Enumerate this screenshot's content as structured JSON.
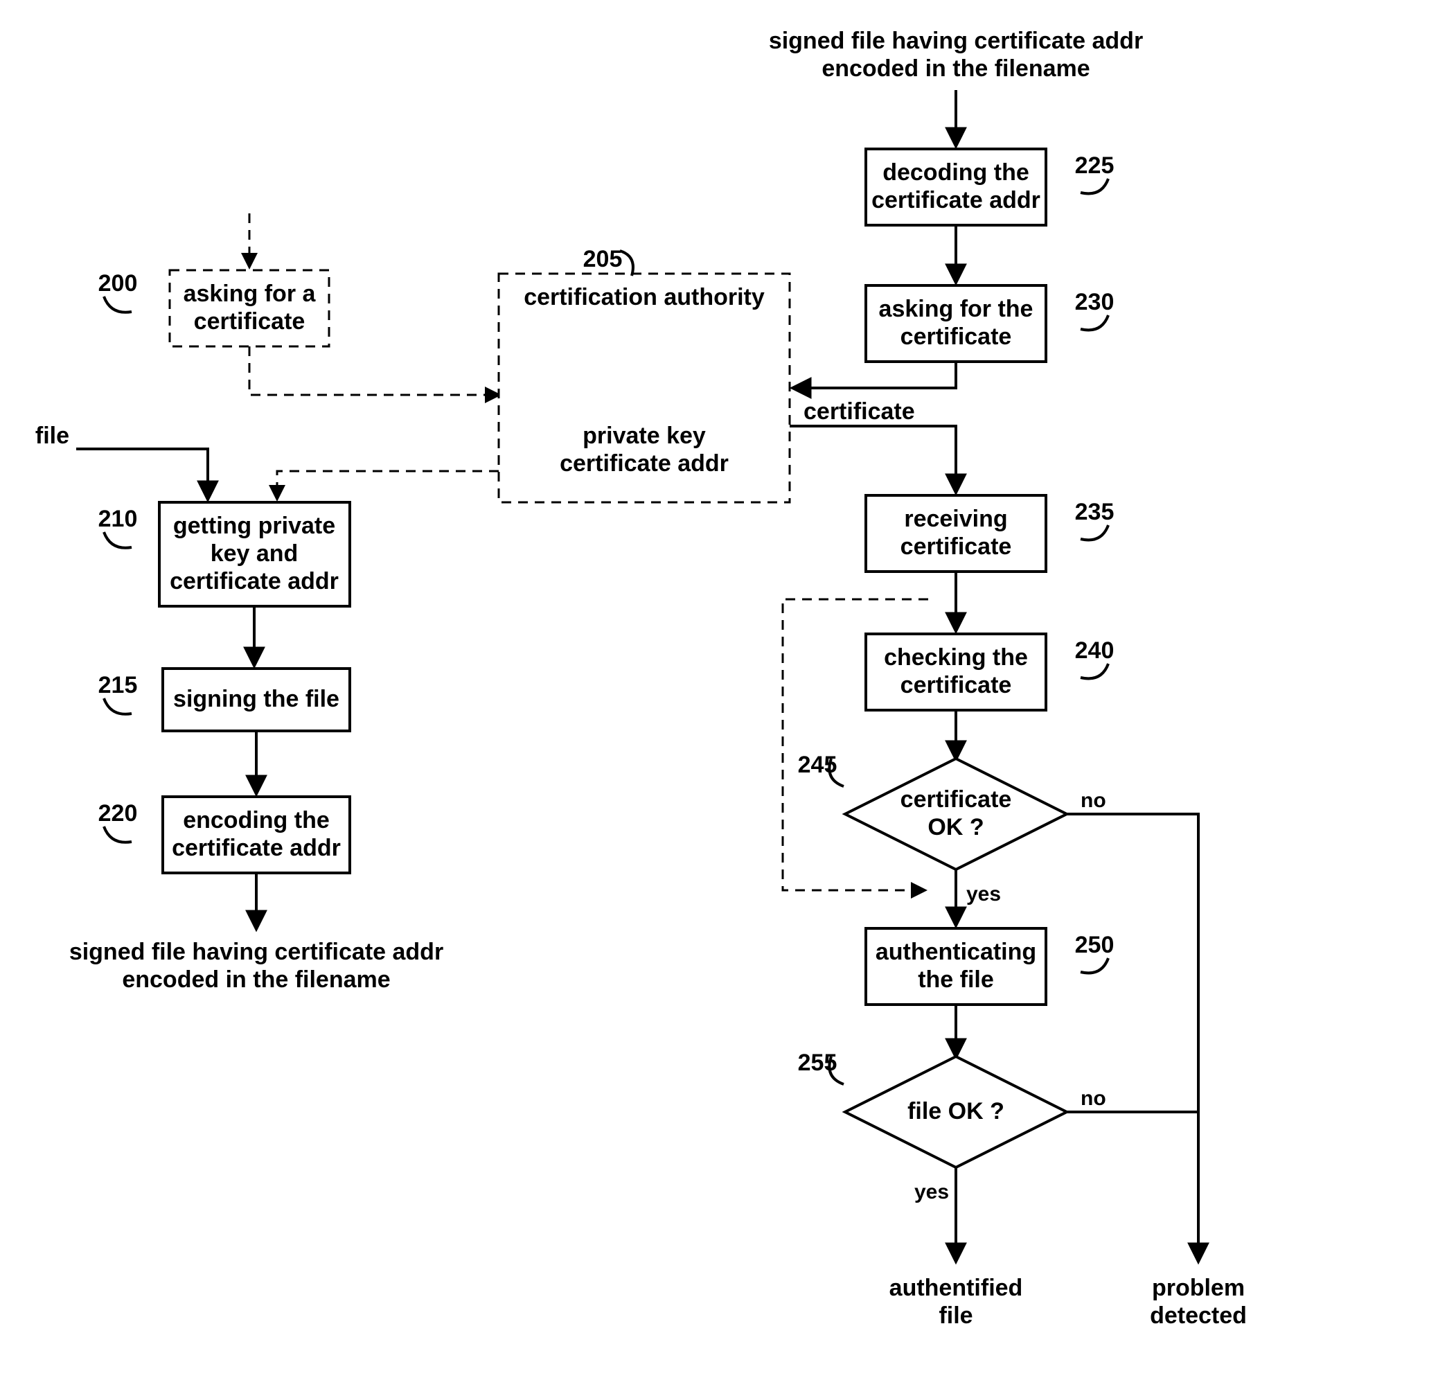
{
  "top_right_input_l1": "signed file having certificate addr",
  "top_right_input_l2": "encoded in the filename",
  "file_label": "file",
  "ca_label": "certification authority",
  "ca_out1": "private key",
  "ca_out2": "certificate addr",
  "ca_out3": "certificate",
  "left_output_l1": "signed file having certificate addr",
  "left_output_l2": "encoded in the filename",
  "yes": "yes",
  "no": "no",
  "outcome_auth_l1": "authentified",
  "outcome_auth_l2": "file",
  "outcome_problem_l1": "problem",
  "outcome_problem_l2": "detected",
  "nodes": {
    "n200": {
      "ref": "200",
      "l1": "asking for a",
      "l2": "certificate"
    },
    "n205": {
      "ref": "205"
    },
    "n210": {
      "ref": "210",
      "l1": "getting private",
      "l2": "key and",
      "l3": "certificate addr"
    },
    "n215": {
      "ref": "215",
      "l1": "signing the file"
    },
    "n220": {
      "ref": "220",
      "l1": "encoding the",
      "l2": "certificate addr"
    },
    "n225": {
      "ref": "225",
      "l1": "decoding the",
      "l2": "certificate addr"
    },
    "n230": {
      "ref": "230",
      "l1": "asking for the",
      "l2": "certificate"
    },
    "n235": {
      "ref": "235",
      "l1": "receiving",
      "l2": "certificate"
    },
    "n240": {
      "ref": "240",
      "l1": "checking the",
      "l2": "certificate"
    },
    "n245": {
      "ref": "245",
      "l1": "certificate",
      "l2": "OK ?"
    },
    "n250": {
      "ref": "250",
      "l1": "authenticating",
      "l2": "the file"
    },
    "n255": {
      "ref": "255",
      "l1": "file OK ?"
    }
  }
}
